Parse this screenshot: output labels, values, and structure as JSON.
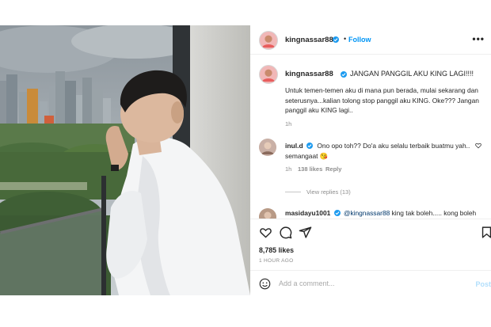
{
  "post": {
    "username": "kingnassar88",
    "follow_label": "Follow",
    "separator": "•",
    "more_label": "•••"
  },
  "caption": {
    "username": "kingnassar88",
    "title": "JANGAN PANGGIL AKU KING LAGI!!!!",
    "body": "Untuk temen-temen aku di mana pun berada, mulai sekarang dan seterusnya...kalian tolong stop panggil aku KING. Oke??? Jangan panggil aku KING lagi..",
    "time": "1h"
  },
  "comments": [
    {
      "username": "inul.d",
      "text": "Ono opo toh?? Do'a aku selalu terbaik buatmu yah.. semangaat 😘",
      "time": "1h",
      "likes": "138 likes",
      "reply_label": "Reply",
      "view_replies": "View replies (13)"
    },
    {
      "username": "masidayu1001",
      "mention": "@kingnassar88",
      "text": "king tak boleh..... kong boleh"
    }
  ],
  "actions": {
    "icons": [
      "heart-icon",
      "comment-icon",
      "share-icon",
      "bookmark-icon"
    ],
    "likes": "8,785 likes",
    "ago": "1 HOUR AGO"
  },
  "add_comment": {
    "placeholder": "Add a comment...",
    "post_label": "Post"
  },
  "colors": {
    "link_blue": "#0095f6",
    "verified_blue": "#1d9bf0",
    "muted": "#8e8e8e",
    "text": "#262626"
  }
}
